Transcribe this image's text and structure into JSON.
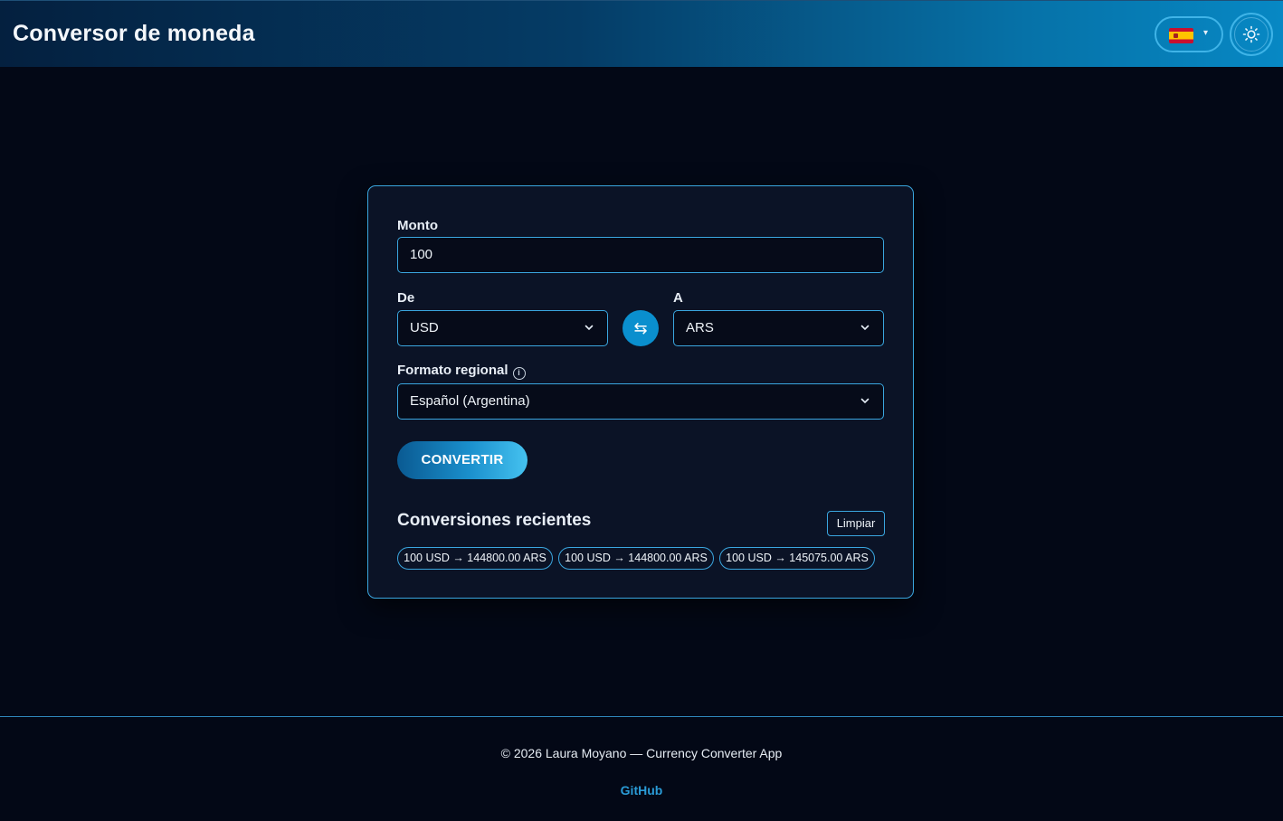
{
  "header": {
    "title": "Conversor de moneda",
    "language": {
      "flag": "spain-flag-icon",
      "caret": "▾"
    },
    "theme_icon": "sun-icon"
  },
  "converter": {
    "amount_label": "Monto",
    "amount_value": "100",
    "from_label": "De",
    "from_value": "USD",
    "to_label": "A",
    "to_value": "ARS",
    "swap_icon": "swap-arrows-icon",
    "swap_glyph": "⇆",
    "locale_label": "Formato regional",
    "locale_info_icon": "info-icon",
    "locale_value": "Español (Argentina)",
    "convert_label": "CONVERTIR"
  },
  "recent": {
    "title": "Conversiones recientes",
    "clear_label": "Limpiar",
    "items": [
      "100 USD → 144800.00 ARS",
      "100 USD → 144800.00 ARS",
      "100 USD → 145075.00 ARS"
    ]
  },
  "footer": {
    "copyright": "© 2026 Laura Moyano — Currency Converter App",
    "link_label": "GitHub"
  },
  "colors": {
    "accent": "#3aa6df",
    "button": "#0a8fce",
    "background": "#030816",
    "card": "#0b1326"
  }
}
